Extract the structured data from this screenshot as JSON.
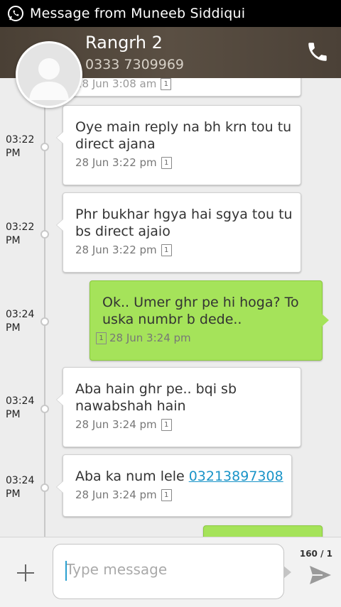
{
  "notification": {
    "text": "Message from Muneeb Siddiqui"
  },
  "contact": {
    "name": "Rangrh 2",
    "number": "0333 7309969"
  },
  "partial_top_message": {
    "meta": "28 Jun 3:08 am"
  },
  "messages": [
    {
      "direction": "in",
      "time": "03:22\nPM",
      "text": "Oye main reply na bh krn tou tu\ndirect ajana",
      "meta": "28 Jun 3:22 pm",
      "sim": "1"
    },
    {
      "direction": "in",
      "time": "03:22\nPM",
      "text": "Phr bukhar hgya hai sgya tou tu\nbs direct ajaio",
      "meta": "28 Jun 3:22 pm",
      "sim": "1"
    },
    {
      "direction": "out",
      "time": "03:24\nPM",
      "text": "Ok.. Umer ghr pe hi hoga? To\nuska numbr b dede..",
      "meta": "28 Jun 3:24 pm",
      "sim": "1"
    },
    {
      "direction": "in",
      "time": "03:24\nPM",
      "text": "Aba hain ghr pe.. bqi sb\nnawabshah hain",
      "meta": "28 Jun 3:24 pm",
      "sim": "1"
    },
    {
      "direction": "in",
      "time": "03:24\nPM",
      "text_prefix": "Aba ka num lele ",
      "link": "03213897308",
      "meta": "28 Jun 3:24 pm",
      "sim": "1"
    }
  ],
  "composer": {
    "placeholder": "Type message",
    "counter": "160 / 1"
  },
  "colors": {
    "header": "#4f453a",
    "outgoing": "#a5e35a",
    "incoming": "#ffffff",
    "link": "#1a94c8"
  }
}
